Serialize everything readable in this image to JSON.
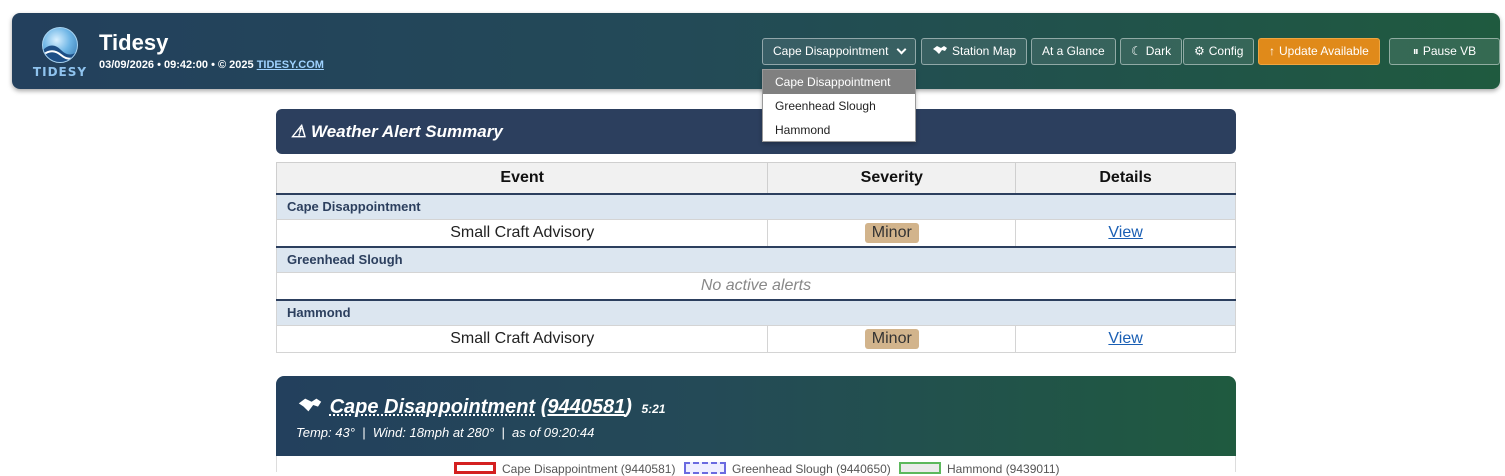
{
  "header": {
    "title": "Tidesy",
    "logo_text": "TIDESY",
    "subtitle": "03/09/2026 • 09:42:00 • © 2025 ",
    "subtitle_link": "TIDESY.COM"
  },
  "toolbar": {
    "station_select": "Cape Disappointment",
    "station_map": "Station Map",
    "at_a_glance": "At a Glance",
    "dark": "Dark",
    "config": "Config",
    "update": "Update Available",
    "pause": "Pause VB"
  },
  "dropdown": {
    "options": [
      "Cape Disappointment",
      "Greenhead Slough",
      "Hammond"
    ],
    "selected_index": 0
  },
  "alerts": {
    "title": "Weather Alert Summary",
    "columns": [
      "Event",
      "Severity",
      "Details"
    ],
    "groups": [
      {
        "station": "Cape Disappointment",
        "event": "Small Craft Advisory",
        "severity": "Minor",
        "details": "View"
      },
      {
        "station": "Greenhead Slough",
        "empty_text": "No active alerts"
      },
      {
        "station": "Hammond",
        "event": "Small Craft Advisory",
        "severity": "Minor",
        "details": "View"
      }
    ]
  },
  "station_card": {
    "name": "Cape Disappointment",
    "id": "9440581",
    "time": "5:21",
    "meta": "Temp: 43°  |  Wind: 18mph at 280°  |  as of 09:20:44"
  },
  "legend": [
    {
      "label": "Cape Disappointment (9440581)",
      "color": "#d42020",
      "style": "solid"
    },
    {
      "label": "Greenhead Slough (9440650)",
      "color": "#6a6ae0",
      "style": "dashed"
    },
    {
      "label": "Hammond (9439011)",
      "color": "#5cb85c",
      "style": "solid"
    }
  ],
  "colors": {
    "accent": "#2c3f5e",
    "update": "#e08a1a",
    "badge_minor": "#d2b48c",
    "link": "#1a5fb4"
  }
}
